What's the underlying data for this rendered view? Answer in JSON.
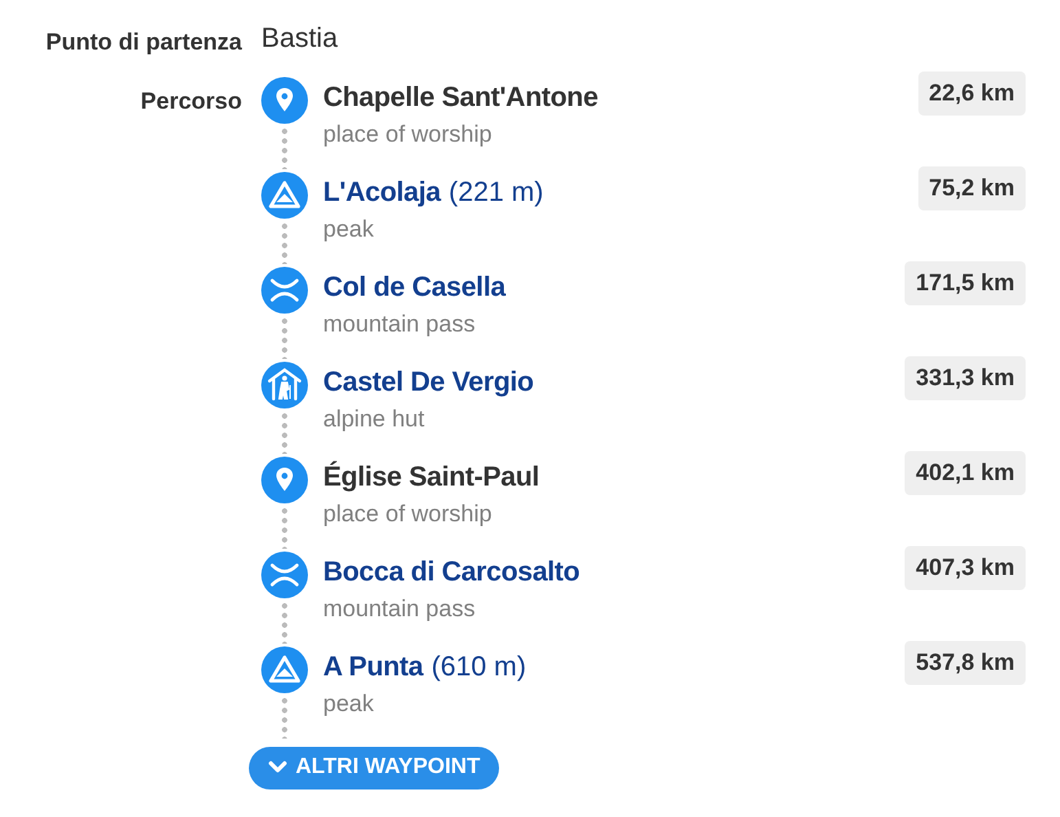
{
  "start": {
    "label": "Punto di partenza",
    "value": "Bastia"
  },
  "route": {
    "label": "Percorso",
    "waypoints": [
      {
        "kind": "pin",
        "name": "Chapelle Sant'Antone",
        "link": false,
        "type": "place of worship",
        "distance": "22,6 km"
      },
      {
        "kind": "peak",
        "name": "L'Acolaja",
        "elevation": "(221 m)",
        "link": true,
        "type": "peak",
        "distance": "75,2 km"
      },
      {
        "kind": "pass",
        "name": "Col de Casella",
        "link": true,
        "type": "mountain pass",
        "distance": "171,5 km"
      },
      {
        "kind": "hut",
        "name": "Castel De Vergio",
        "link": true,
        "type": "alpine hut",
        "distance": "331,3 km"
      },
      {
        "kind": "pin",
        "name": "Église Saint-Paul",
        "link": false,
        "type": "place of worship",
        "distance": "402,1 km"
      },
      {
        "kind": "pass",
        "name": "Bocca di Carcosalto",
        "link": true,
        "type": "mountain pass",
        "distance": "407,3 km"
      },
      {
        "kind": "peak",
        "name": "A Punta",
        "elevation": "(610 m)",
        "link": true,
        "type": "peak",
        "distance": "537,8 km"
      }
    ],
    "more_button": "ALTRI WAYPOINT"
  }
}
